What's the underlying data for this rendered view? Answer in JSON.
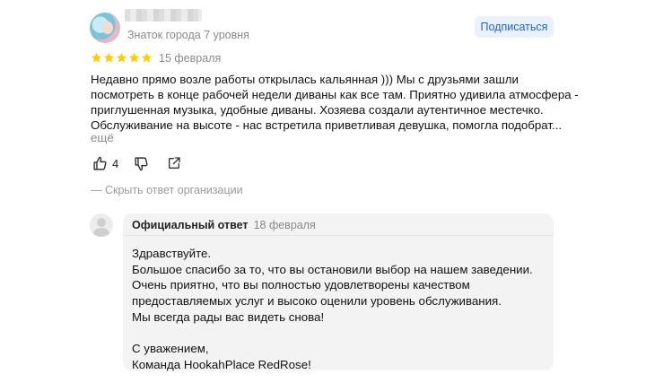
{
  "review": {
    "author_level": "Знаток города 7 уровня",
    "subscribe_label": "Подписаться",
    "rating": 5,
    "date": "15 февраля",
    "text_lines": [
      "Недавно прямо возле работы открылась кальянная ))) Мы с друзьями зашли",
      "посмотреть в конце рабочей недели диваны как все там. Приятно удивила атмосфера -",
      "приглушенная музыка, удобные диваны. Хозяева создали аутентичное местечко.",
      "Обслуживание на высоте - нас встретила приветливая девушка, помогла подобрат..."
    ],
    "more_label": "ещё",
    "likes_count": "4",
    "hide_answer_label": "— Скрыть ответ организации"
  },
  "reply": {
    "title": "Официальный ответ",
    "date": "18 февраля",
    "lines": [
      "Здравствуйте.",
      "Большое спасибо за то, что вы остановили выбор на нашем заведении.",
      "Очень приятно, что вы полностью удовлетворены качеством",
      "предоставляемых услуг и высоко оценили уровень обслуживания.",
      "Мы всегда рады вас видеть снова!",
      "",
      "С уважением,",
      "Команда HookahPlace RedRose!"
    ]
  },
  "colors": {
    "star": "#ffcc00",
    "link_blue": "#1a63d6",
    "muted": "#8a8a8a",
    "reply_bg": "#f3f3f3"
  },
  "icons": {
    "like": "thumb-up-icon",
    "dislike": "thumb-down-icon",
    "share": "share-icon",
    "org_avatar": "user-placeholder-icon"
  }
}
